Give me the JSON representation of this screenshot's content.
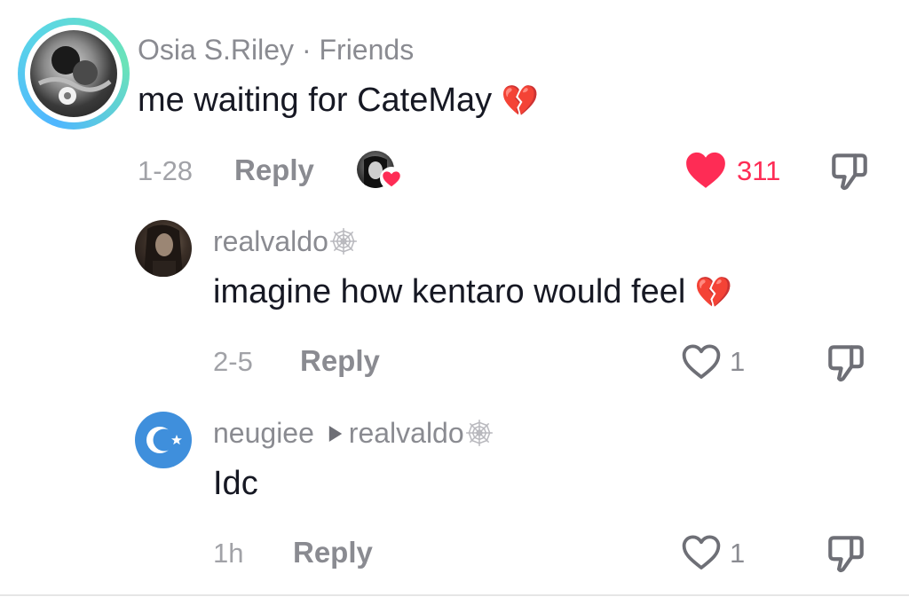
{
  "comments": [
    {
      "username": "Osia S.Riley",
      "relation": "Friends",
      "separator": "·",
      "text": "me waiting for CateMay",
      "emoji": "💔",
      "time": "1-28",
      "reply_label": "Reply",
      "likes": "311",
      "liked": true
    },
    {
      "username": "realvaldo",
      "text": "imagine how kentaro would feel",
      "emoji": "💔",
      "time": "2-5",
      "reply_label": "Reply",
      "likes": "1",
      "liked": false
    },
    {
      "username": "neugiee",
      "reply_to": "realvaldo",
      "text": "Idc",
      "time": "1h",
      "reply_label": "Reply",
      "likes": "1",
      "liked": false
    }
  ],
  "colors": {
    "like_red": "#fe2c55",
    "muted_text": "#8a8b91",
    "avatar_ring": "#5bd6e6",
    "flag_blue": "#3f8fdc"
  },
  "icons": {
    "like": "heart-icon",
    "dislike": "thumbs-down-icon",
    "badge": "spiderweb-icon",
    "reply_arrow": "play-arrow-icon"
  }
}
